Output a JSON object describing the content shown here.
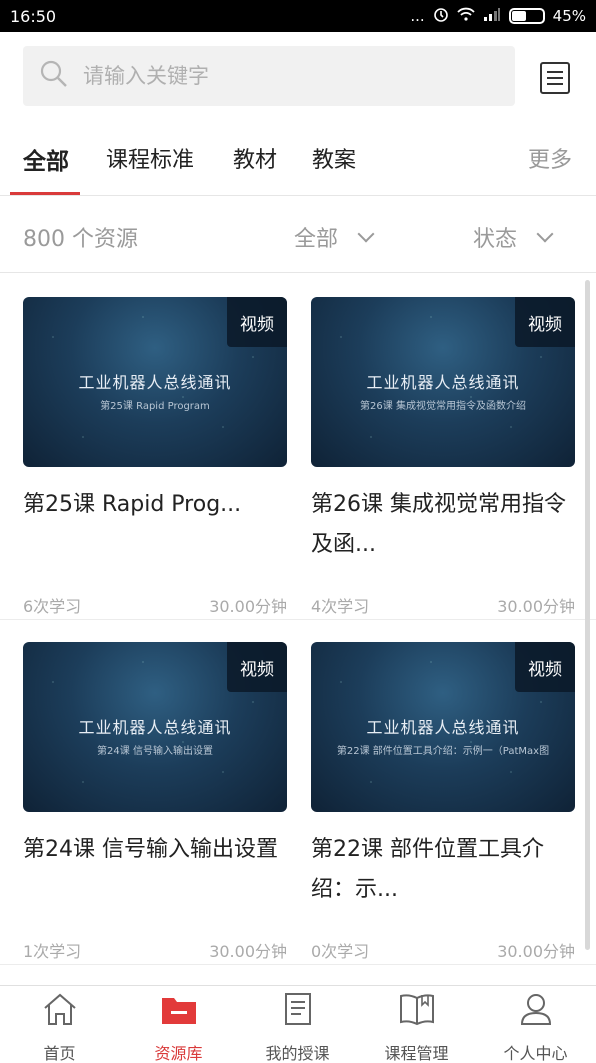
{
  "status_bar": {
    "time": "16:50",
    "signal_text": "...",
    "battery": "45%"
  },
  "search": {
    "placeholder": "请输入关键字"
  },
  "tabs": [
    {
      "label": "全部",
      "active": true
    },
    {
      "label": "课程标准",
      "active": false
    },
    {
      "label": "教材",
      "active": false
    },
    {
      "label": "教案",
      "active": false
    }
  ],
  "more_label": "更多",
  "filter": {
    "count_label": "800 个资源",
    "type_label": "全部",
    "status_label": "状态"
  },
  "cards": [
    {
      "badge": "视频",
      "thumb_title": "工业机器人总线通讯",
      "thumb_sub": "第25课 Rapid Program",
      "title": "第25课 Rapid Prog...",
      "views": "6次学习",
      "duration": "30.00分钟"
    },
    {
      "badge": "视频",
      "thumb_title": "工业机器人总线通讯",
      "thumb_sub": "第26课 集成视觉常用指令及函数介绍",
      "title": "第26课 集成视觉常用指令及函...",
      "views": "4次学习",
      "duration": "30.00分钟"
    },
    {
      "badge": "视频",
      "thumb_title": "工业机器人总线通讯",
      "thumb_sub": "第24课 信号输入输出设置",
      "title": "第24课 信号输入输出设置",
      "views": "1次学习",
      "duration": "30.00分钟"
    },
    {
      "badge": "视频",
      "thumb_title": "工业机器人总线通讯",
      "thumb_sub": "第22课 部件位置工具介绍：示例一（PatMax图",
      "title": "第22课 部件位置工具介绍：示...",
      "views": "0次学习",
      "duration": "30.00分钟"
    }
  ],
  "bottom_nav": [
    {
      "label": "首页",
      "icon": "home-icon",
      "active": false
    },
    {
      "label": "资源库",
      "icon": "folder-icon",
      "active": true
    },
    {
      "label": "我的授课",
      "icon": "document-icon",
      "active": false
    },
    {
      "label": "课程管理",
      "icon": "book-icon",
      "active": false
    },
    {
      "label": "个人中心",
      "icon": "user-icon",
      "active": false
    }
  ],
  "colors": {
    "accent": "#d93a3a",
    "muted": "#9a9a9a"
  }
}
